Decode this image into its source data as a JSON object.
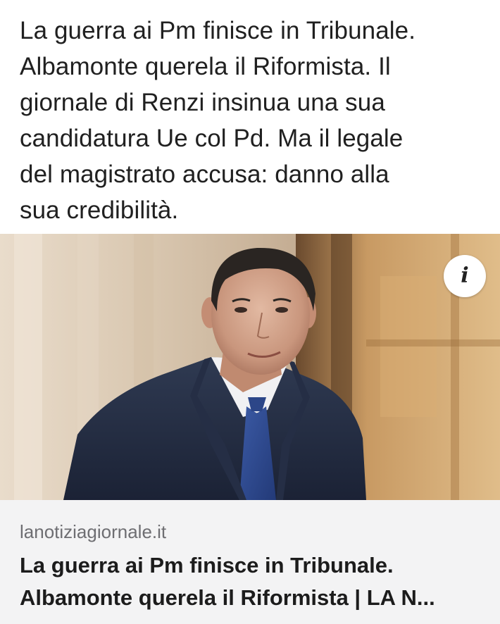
{
  "post": {
    "lines": [
      "La guerra ai Pm finisce in Tribunale.",
      "Albamonte querela il Riformista. Il",
      "giornale di Renzi insinua una sua",
      "candidatura Ue col Pd. Ma il legale",
      "del magistrato accusa: danno alla",
      "sua credibilità."
    ]
  },
  "link_card": {
    "info_icon": "info-icon",
    "info_glyph": "i",
    "domain": "lanotiziagiornale.it",
    "title_lines": [
      "La guerra ai Pm finisce in Tribunale.",
      "Albamonte querela il Riformista | LA N..."
    ]
  },
  "colors": {
    "background": "#ffffff",
    "card_meta_background": "#f3f3f4",
    "domain_text": "#6e6e72",
    "title_text": "#1c1c1c"
  }
}
